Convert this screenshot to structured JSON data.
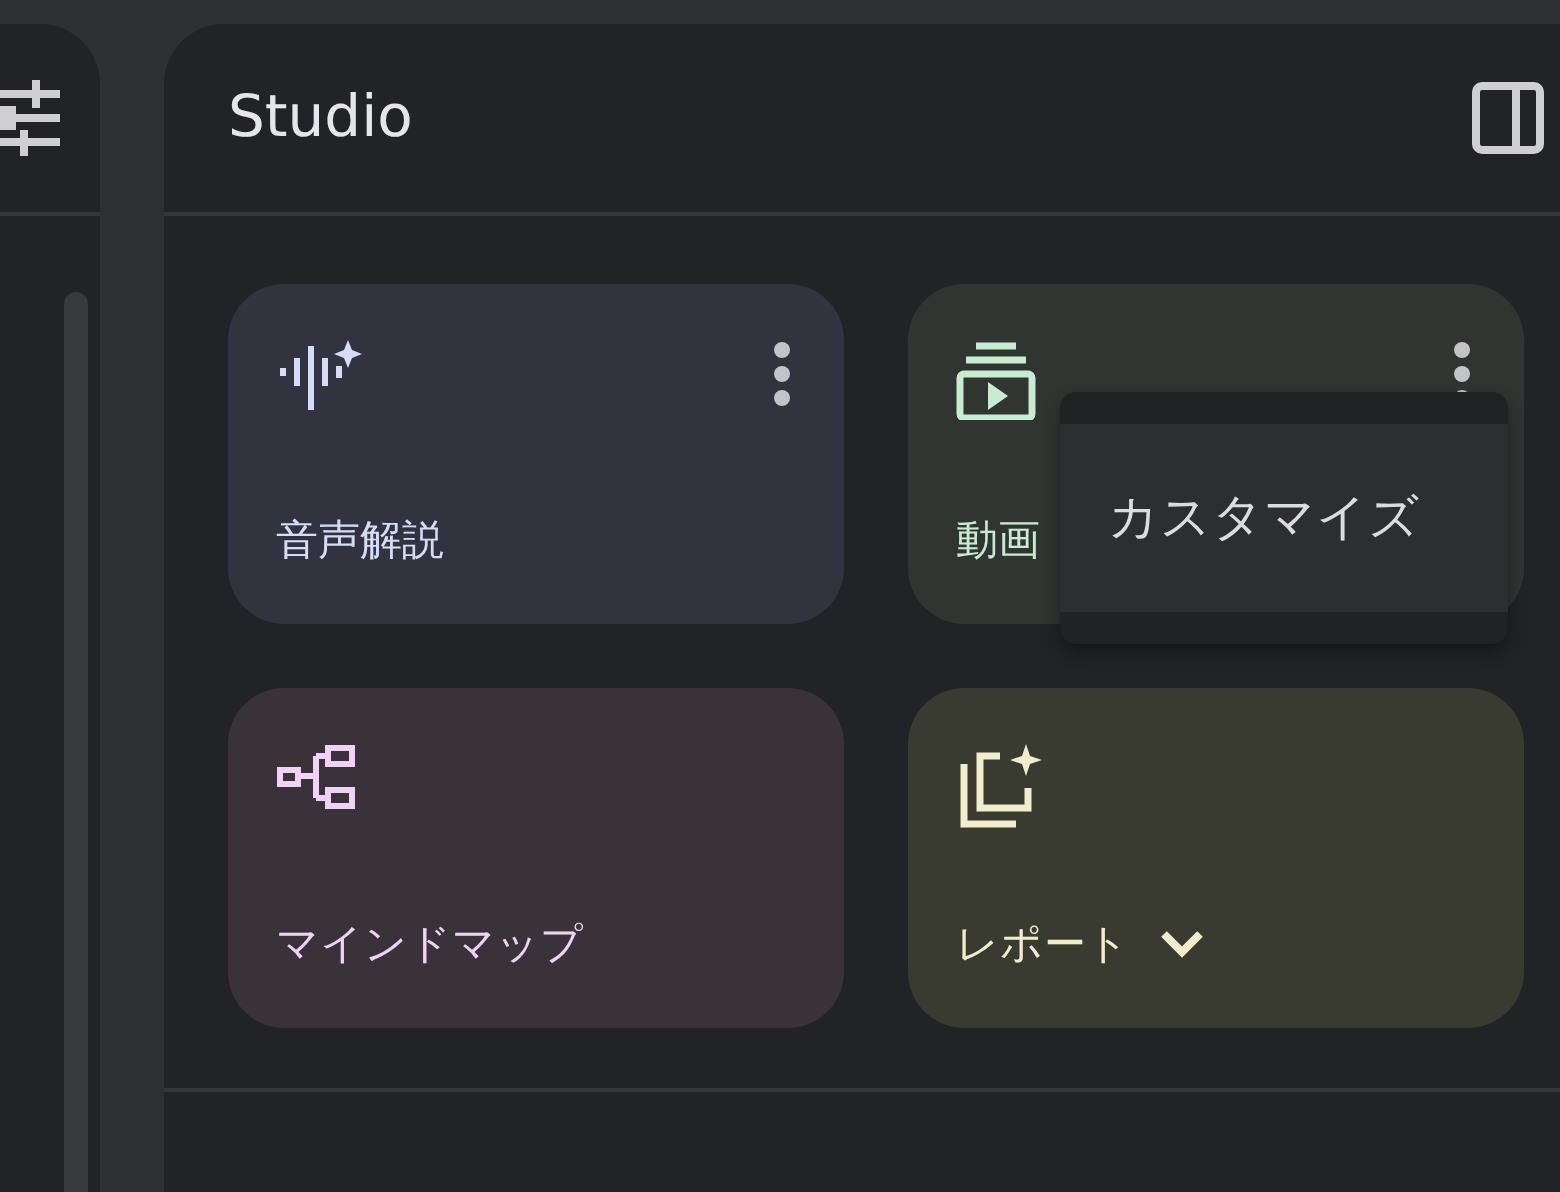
{
  "panel": {
    "title": "Studio"
  },
  "cards": [
    {
      "label": "音声解説",
      "kind": "menu",
      "color": "#31343f"
    },
    {
      "label": "動画",
      "kind": "menu",
      "color": "#313531"
    },
    {
      "label": "マインドマップ",
      "kind": "plain",
      "color": "#3a3239"
    },
    {
      "label": "レポート",
      "kind": "dropdown",
      "color": "#393a30"
    }
  ],
  "popup_menu": {
    "items": [
      "カスタマイズ"
    ]
  }
}
